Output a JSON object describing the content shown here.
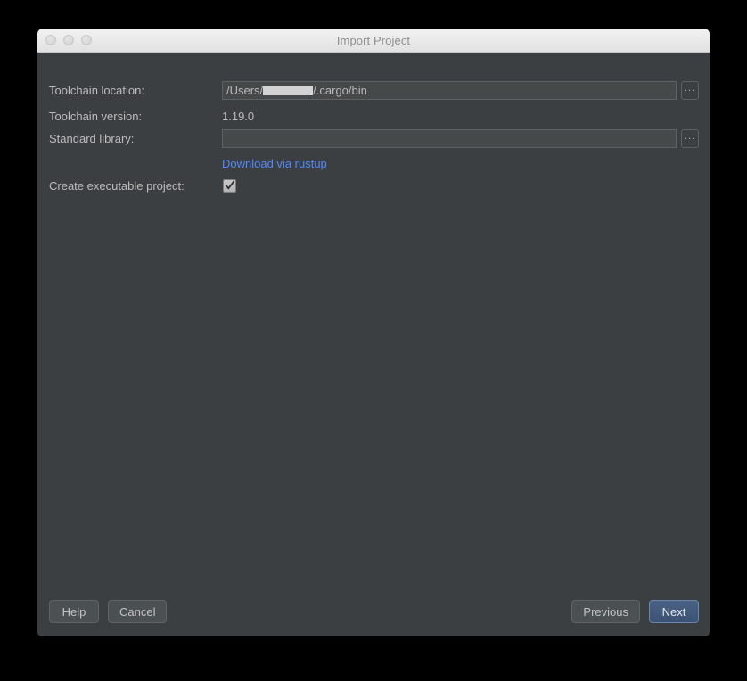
{
  "window": {
    "title": "Import Project",
    "traffic_lights": [
      "close-light",
      "minimize-light",
      "zoom-light"
    ]
  },
  "form": {
    "toolchain_location": {
      "label": "Toolchain location:",
      "value_prefix": "/Users/",
      "value_redacted": "",
      "value_suffix": "/.cargo/bin",
      "browse_label": "...",
      "placeholder": ""
    },
    "toolchain_version": {
      "label": "Toolchain version:",
      "value": "1.19.0"
    },
    "standard_library": {
      "label": "Standard library:",
      "value": "",
      "placeholder": "",
      "browse_label": "..."
    },
    "download_link": {
      "label": "Download via rustup"
    },
    "create_executable": {
      "label": "Create executable project:",
      "checked": true
    }
  },
  "footer": {
    "help_label": "Help",
    "cancel_label": "Cancel",
    "previous_label": "Previous",
    "next_label": "Next"
  },
  "colors": {
    "dialog_bg": "#3c3f41",
    "titlebar_bg": "#ebebeb",
    "link": "#548af7",
    "default_button": "#44598a",
    "text": "#bcbcbc"
  }
}
